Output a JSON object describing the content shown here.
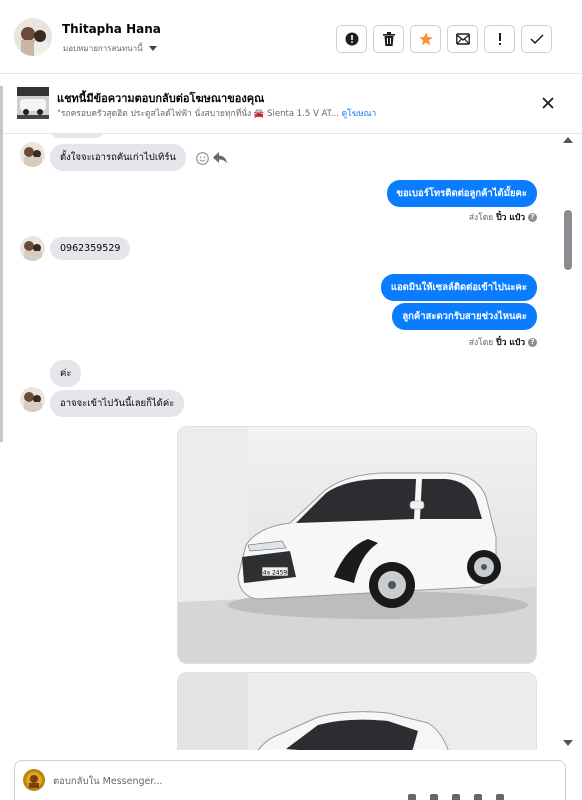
{
  "header": {
    "name": "Thitapha Hana",
    "assign_label": "มอบหมายการสนทนานี้",
    "actions": [
      "mark-spam",
      "delete",
      "star",
      "move-to-done",
      "follow-up",
      "complete"
    ]
  },
  "ad": {
    "title": "แชทนี้มีข้อความตอบกลับต่อโฆษณาของคุณ",
    "subtitle": "\"รถครอบครัวสุดฮิต ประตูสไลด์ไฟฟ้า นั่งสบายทุกที่นั่ง 🚘 Sienta 1.5 V AT...",
    "link": "ดูโฆษณา"
  },
  "messages": {
    "m1": "ตั้งใจจะเอารถคันเก่าไปเทิร์น",
    "m2": "ขอเบอร์โทรติดต่อลูกค้าได้มั้ยคะ",
    "m3": "0962359529",
    "m4": "แอดมินให้เซลล์ติดต่อเข้าไปนะคะ",
    "m5": "ลูกค้าสะดวกรับสายช่วงไหนคะ",
    "m6": "ค่ะ",
    "m7": "อาจจะเข้าไปวันนี้เลยก็ได้ค่ะ"
  },
  "sent_by": {
    "prefix": "ส่งโดย",
    "name": "ปิ๋ว แป๋ว"
  },
  "car": {
    "plate": "4จ 2459"
  },
  "composer": {
    "placeholder": "ตอบกลับใน Messenger..."
  },
  "colors": {
    "outgoing": "#0a7cff",
    "incoming": "#e4e6eb",
    "star": "#f7923a"
  }
}
